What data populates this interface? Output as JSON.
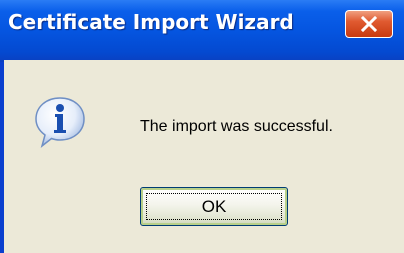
{
  "window": {
    "title": "Certificate Import Wizard",
    "close_icon": "close-icon"
  },
  "dialog": {
    "icon": "info-icon",
    "message": "The import was successful.",
    "ok_label": "OK"
  },
  "colors": {
    "titlebar": "#0555e0",
    "client_background": "#ece9d8",
    "close_button": "#e05a30",
    "info_icon_blue": "#1a4fb0"
  }
}
